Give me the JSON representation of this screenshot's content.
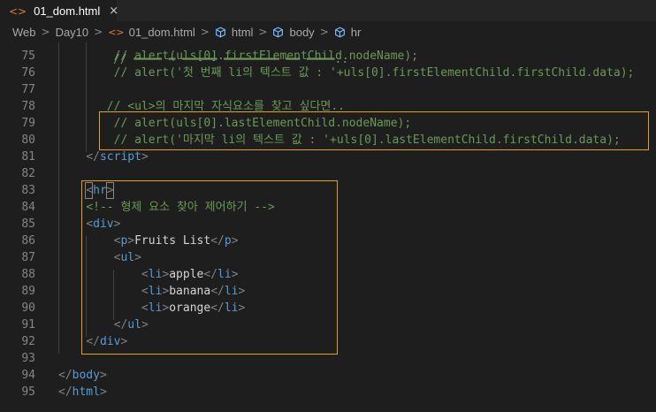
{
  "tab": {
    "icon": "<>",
    "label": "01_dom.html",
    "close": "×"
  },
  "breadcrumb": {
    "items": [
      "Web",
      "Day10",
      "01_dom.html",
      "html",
      "body",
      "hr"
    ],
    "file_icon": "<>",
    "separator": ">"
  },
  "editor": {
    "lines": [
      {
        "n": "75",
        "indent": "        ",
        "parts": [
          {
            "t": "// alert(uls[0].firstElementChild.nodeName);",
            "k": "comment"
          }
        ]
      },
      {
        "n": "76",
        "indent": "        ",
        "parts": [
          {
            "t": "// alert('첫 번째 li의 텍스트 값 : '+uls[0].firstElementChild.firstChild.data);",
            "k": "comment"
          }
        ]
      },
      {
        "n": "77",
        "indent": "",
        "parts": []
      },
      {
        "n": "78",
        "indent": "       ",
        "parts": [
          {
            "t": "// <ul>의 마지막 자식요소를 찾고 싶다면..",
            "k": "comment"
          }
        ]
      },
      {
        "n": "79",
        "indent": "        ",
        "parts": [
          {
            "t": "// alert(uls[0].lastElementChild.nodeName);",
            "k": "comment"
          }
        ]
      },
      {
        "n": "80",
        "indent": "        ",
        "parts": [
          {
            "t": "// alert('마지막 li의 텍스트 값 : '+uls[0].lastElementChild.firstChild.data);",
            "k": "comment"
          }
        ]
      },
      {
        "n": "81",
        "indent": "    ",
        "parts": [
          {
            "t": "</",
            "k": "punc"
          },
          {
            "t": "script",
            "k": "tag"
          },
          {
            "t": ">",
            "k": "punc"
          }
        ]
      },
      {
        "n": "82",
        "indent": "",
        "parts": []
      },
      {
        "n": "83",
        "indent": "    ",
        "parts": [
          {
            "t": "<",
            "k": "punc"
          },
          {
            "t": "hr",
            "k": "tag"
          },
          {
            "t": ">",
            "k": "punc"
          }
        ]
      },
      {
        "n": "84",
        "indent": "    ",
        "parts": [
          {
            "t": "<!-- 형제 요소 찾아 제어하기 -->",
            "k": "comment"
          }
        ]
      },
      {
        "n": "85",
        "indent": "    ",
        "parts": [
          {
            "t": "<",
            "k": "punc"
          },
          {
            "t": "div",
            "k": "tag"
          },
          {
            "t": ">",
            "k": "punc"
          }
        ]
      },
      {
        "n": "86",
        "indent": "        ",
        "parts": [
          {
            "t": "<",
            "k": "punc"
          },
          {
            "t": "p",
            "k": "tag"
          },
          {
            "t": ">",
            "k": "punc"
          },
          {
            "t": "Fruits List",
            "k": "text"
          },
          {
            "t": "</",
            "k": "punc"
          },
          {
            "t": "p",
            "k": "tag"
          },
          {
            "t": ">",
            "k": "punc"
          }
        ]
      },
      {
        "n": "87",
        "indent": "        ",
        "parts": [
          {
            "t": "<",
            "k": "punc"
          },
          {
            "t": "ul",
            "k": "tag"
          },
          {
            "t": ">",
            "k": "punc"
          }
        ]
      },
      {
        "n": "88",
        "indent": "            ",
        "parts": [
          {
            "t": "<",
            "k": "punc"
          },
          {
            "t": "li",
            "k": "tag"
          },
          {
            "t": ">",
            "k": "punc"
          },
          {
            "t": "apple",
            "k": "text"
          },
          {
            "t": "</",
            "k": "punc"
          },
          {
            "t": "li",
            "k": "tag"
          },
          {
            "t": ">",
            "k": "punc"
          }
        ]
      },
      {
        "n": "89",
        "indent": "            ",
        "parts": [
          {
            "t": "<",
            "k": "punc"
          },
          {
            "t": "li",
            "k": "tag"
          },
          {
            "t": ">",
            "k": "punc"
          },
          {
            "t": "banana",
            "k": "text"
          },
          {
            "t": "</",
            "k": "punc"
          },
          {
            "t": "li",
            "k": "tag"
          },
          {
            "t": ">",
            "k": "punc"
          }
        ]
      },
      {
        "n": "90",
        "indent": "            ",
        "parts": [
          {
            "t": "<",
            "k": "punc"
          },
          {
            "t": "li",
            "k": "tag"
          },
          {
            "t": ">",
            "k": "punc"
          },
          {
            "t": "orange",
            "k": "text"
          },
          {
            "t": "</",
            "k": "punc"
          },
          {
            "t": "li",
            "k": "tag"
          },
          {
            "t": ">",
            "k": "punc"
          }
        ]
      },
      {
        "n": "91",
        "indent": "        ",
        "parts": [
          {
            "t": "</",
            "k": "punc"
          },
          {
            "t": "ul",
            "k": "tag"
          },
          {
            "t": ">",
            "k": "punc"
          }
        ]
      },
      {
        "n": "92",
        "indent": "    ",
        "parts": [
          {
            "t": "</",
            "k": "punc"
          },
          {
            "t": "div",
            "k": "tag"
          },
          {
            "t": ">",
            "k": "punc"
          }
        ]
      },
      {
        "n": "93",
        "indent": "",
        "parts": []
      },
      {
        "n": "94",
        "indent": "",
        "parts": [
          {
            "t": "</",
            "k": "punc"
          },
          {
            "t": "body",
            "k": "tag"
          },
          {
            "t": ">",
            "k": "punc"
          }
        ]
      },
      {
        "n": "95",
        "indent": "",
        "parts": [
          {
            "t": "</",
            "k": "punc"
          },
          {
            "t": "html",
            "k": "tag"
          },
          {
            "t": ">",
            "k": "punc"
          }
        ]
      }
    ]
  },
  "colors": {
    "background": "#1e1e1e",
    "comment": "#6a9955",
    "tag": "#569cd6",
    "highlight_box": "#e3a21a"
  }
}
